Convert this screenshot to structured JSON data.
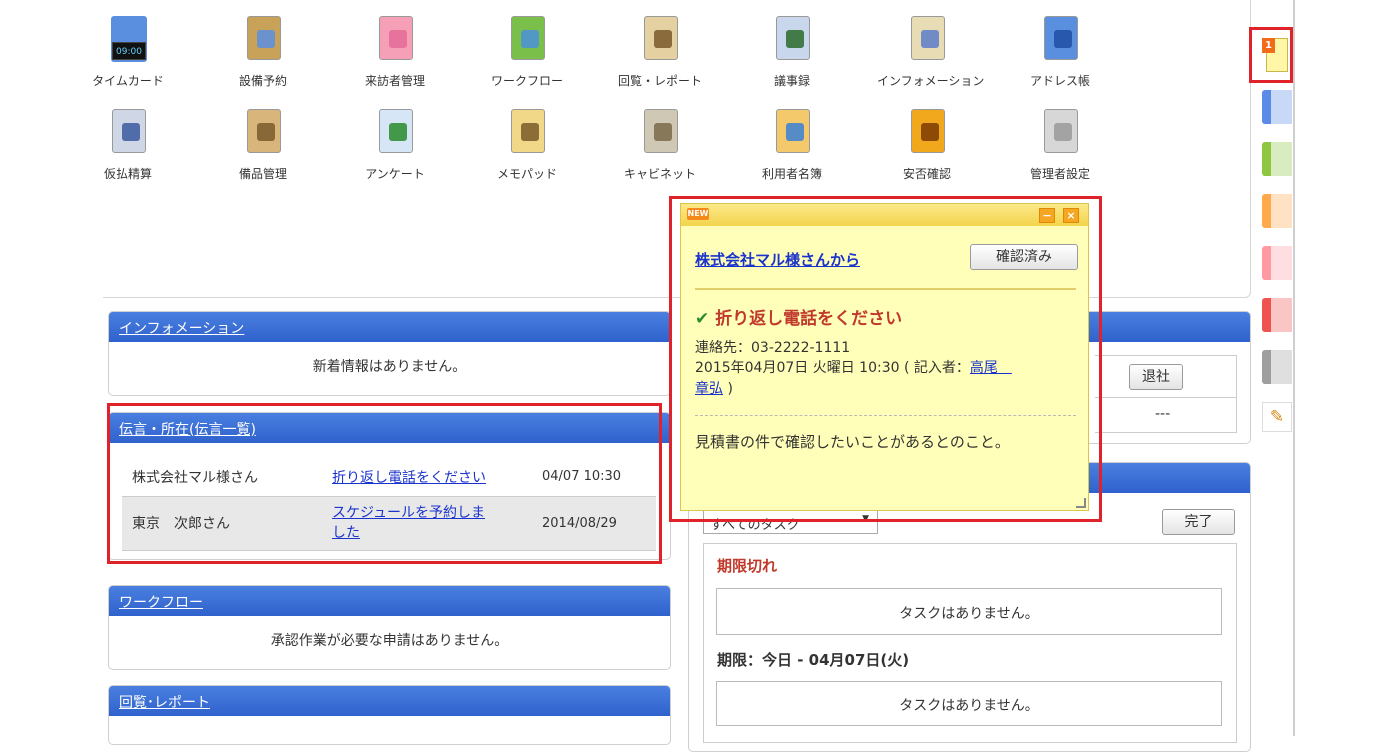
{
  "apps": [
    {
      "label": "タイムカード",
      "icon": "timecard-icon"
    },
    {
      "label": "設備予約",
      "icon": "facility-reservation-icon"
    },
    {
      "label": "来訪者管理",
      "icon": "visitor-management-icon"
    },
    {
      "label": "ワークフロー",
      "icon": "workflow-icon"
    },
    {
      "label": "回覧・レポート",
      "icon": "circular-report-icon"
    },
    {
      "label": "議事録",
      "icon": "minutes-icon"
    },
    {
      "label": "インフォメーション",
      "icon": "information-icon"
    },
    {
      "label": "アドレス帳",
      "icon": "address-book-icon"
    },
    {
      "label": "仮払精算",
      "icon": "advance-payment-icon"
    },
    {
      "label": "備品管理",
      "icon": "equipment-management-icon"
    },
    {
      "label": "アンケート",
      "icon": "survey-icon"
    },
    {
      "label": "メモパッド",
      "icon": "memo-pad-icon"
    },
    {
      "label": "キャビネット",
      "icon": "cabinet-icon"
    },
    {
      "label": "利用者名簿",
      "icon": "user-directory-icon"
    },
    {
      "label": "安否確認",
      "icon": "safety-confirmation-icon"
    },
    {
      "label": "管理者設定",
      "icon": "admin-settings-icon"
    }
  ],
  "timecard_clock": "09:00",
  "panels": {
    "information": {
      "title": "インフォメーション",
      "empty": "新着情報はありません。"
    },
    "messages": {
      "title": "伝言・所在(伝言一覧)",
      "rows": [
        {
          "from": "株式会社マル様さん",
          "subject": "折り返し電話をください",
          "date": "04/07 10:30"
        },
        {
          "from": "東京　次郎さん",
          "subject_line1": "スケジュールを予約しま",
          "subject_line2": "した",
          "date": "2014/08/29"
        }
      ]
    },
    "workflow": {
      "title": "ワークフロー",
      "empty": "承認作業が必要な申請はありません。"
    },
    "circular": {
      "title": "回覧･レポート"
    }
  },
  "attendance": {
    "leave_button": "退社",
    "value": "---"
  },
  "tasks": {
    "filter": "すべてのタスク",
    "complete_button": "完了",
    "overdue_label": "期限切れ",
    "overdue_empty": "タスクはありません。",
    "today_label": "期限：今日 - 04月07日(火)",
    "today_empty": "タスクはありません。"
  },
  "note": {
    "badge": "NEW",
    "from": "株式会社マル様さんから",
    "confirm_button": "確認済み",
    "subject": "折り返し電話をください",
    "contact": "連絡先：03-2222-1111",
    "datetime_prefix": "2015年04月07日 火曜日 10:30 ( 記入者：",
    "author_part1": "高尾　",
    "author_part2": "章弘",
    "datetime_suffix": " )",
    "body": "見積書の件で確認したいことがあるとのこと。",
    "minimize": "−",
    "close": "×"
  },
  "notification_count": "1",
  "colors": {
    "header_blue": "#3a6fd8",
    "note_yellow": "#ffffb9",
    "highlight_red": "#e0222a",
    "tab_colors": [
      "#5b8be6",
      "#8dc63f",
      "#ffa94d",
      "#ff9aa2",
      "#ef5350",
      "#9e9e9e"
    ]
  }
}
